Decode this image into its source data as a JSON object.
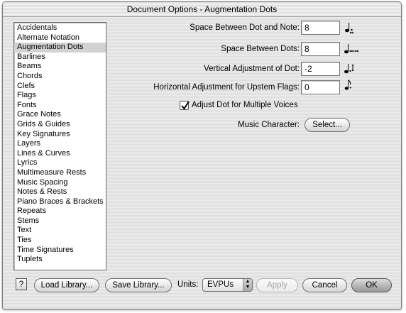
{
  "window": {
    "title": "Document Options - Augmentation Dots"
  },
  "categories": [
    {
      "label": "Accidentals"
    },
    {
      "label": "Alternate Notation"
    },
    {
      "label": "Augmentation Dots",
      "selected": true
    },
    {
      "label": "Barlines"
    },
    {
      "label": "Beams"
    },
    {
      "label": "Chords"
    },
    {
      "label": "Clefs"
    },
    {
      "label": "Flags"
    },
    {
      "label": "Fonts"
    },
    {
      "label": "Grace Notes"
    },
    {
      "label": "Grids & Guides"
    },
    {
      "label": "Key Signatures"
    },
    {
      "label": "Layers"
    },
    {
      "label": "Lines & Curves"
    },
    {
      "label": "Lyrics"
    },
    {
      "label": "Multimeasure Rests"
    },
    {
      "label": "Music Spacing"
    },
    {
      "label": "Notes & Rests"
    },
    {
      "label": "Piano Braces & Brackets"
    },
    {
      "label": "Repeats"
    },
    {
      "label": "Stems"
    },
    {
      "label": "Text"
    },
    {
      "label": "Ties"
    },
    {
      "label": "Time Signatures"
    },
    {
      "label": "Tuplets"
    }
  ],
  "settings": {
    "dot_note_space": {
      "label": "Space Between Dot and Note:",
      "value": "8",
      "icon": "note-dot-spacing-icon"
    },
    "dots_space": {
      "label": "Space Between Dots:",
      "value": "8",
      "icon": "double-dot-spacing-icon"
    },
    "vertical_adjust": {
      "label": "Vertical Adjustment of Dot:",
      "value": "-2",
      "icon": "dot-vertical-adjust-icon"
    },
    "horizontal_upstem": {
      "label": "Horizontal Adjustment for Upstem Flags:",
      "value": "0",
      "icon": "upstem-flag-dot-icon"
    },
    "adjust_multiple_voices": {
      "label": "Adjust Dot for Multiple Voices",
      "checked": true
    },
    "music_character": {
      "label": "Music Character:",
      "button_label": "Select..."
    }
  },
  "footer": {
    "help_label": "?",
    "load_library_label": "Load Library...",
    "save_library_label": "Save Library...",
    "units_label": "Units:",
    "units_value": "EVPUs",
    "apply_label": "Apply",
    "cancel_label": "Cancel",
    "ok_label": "OK"
  }
}
